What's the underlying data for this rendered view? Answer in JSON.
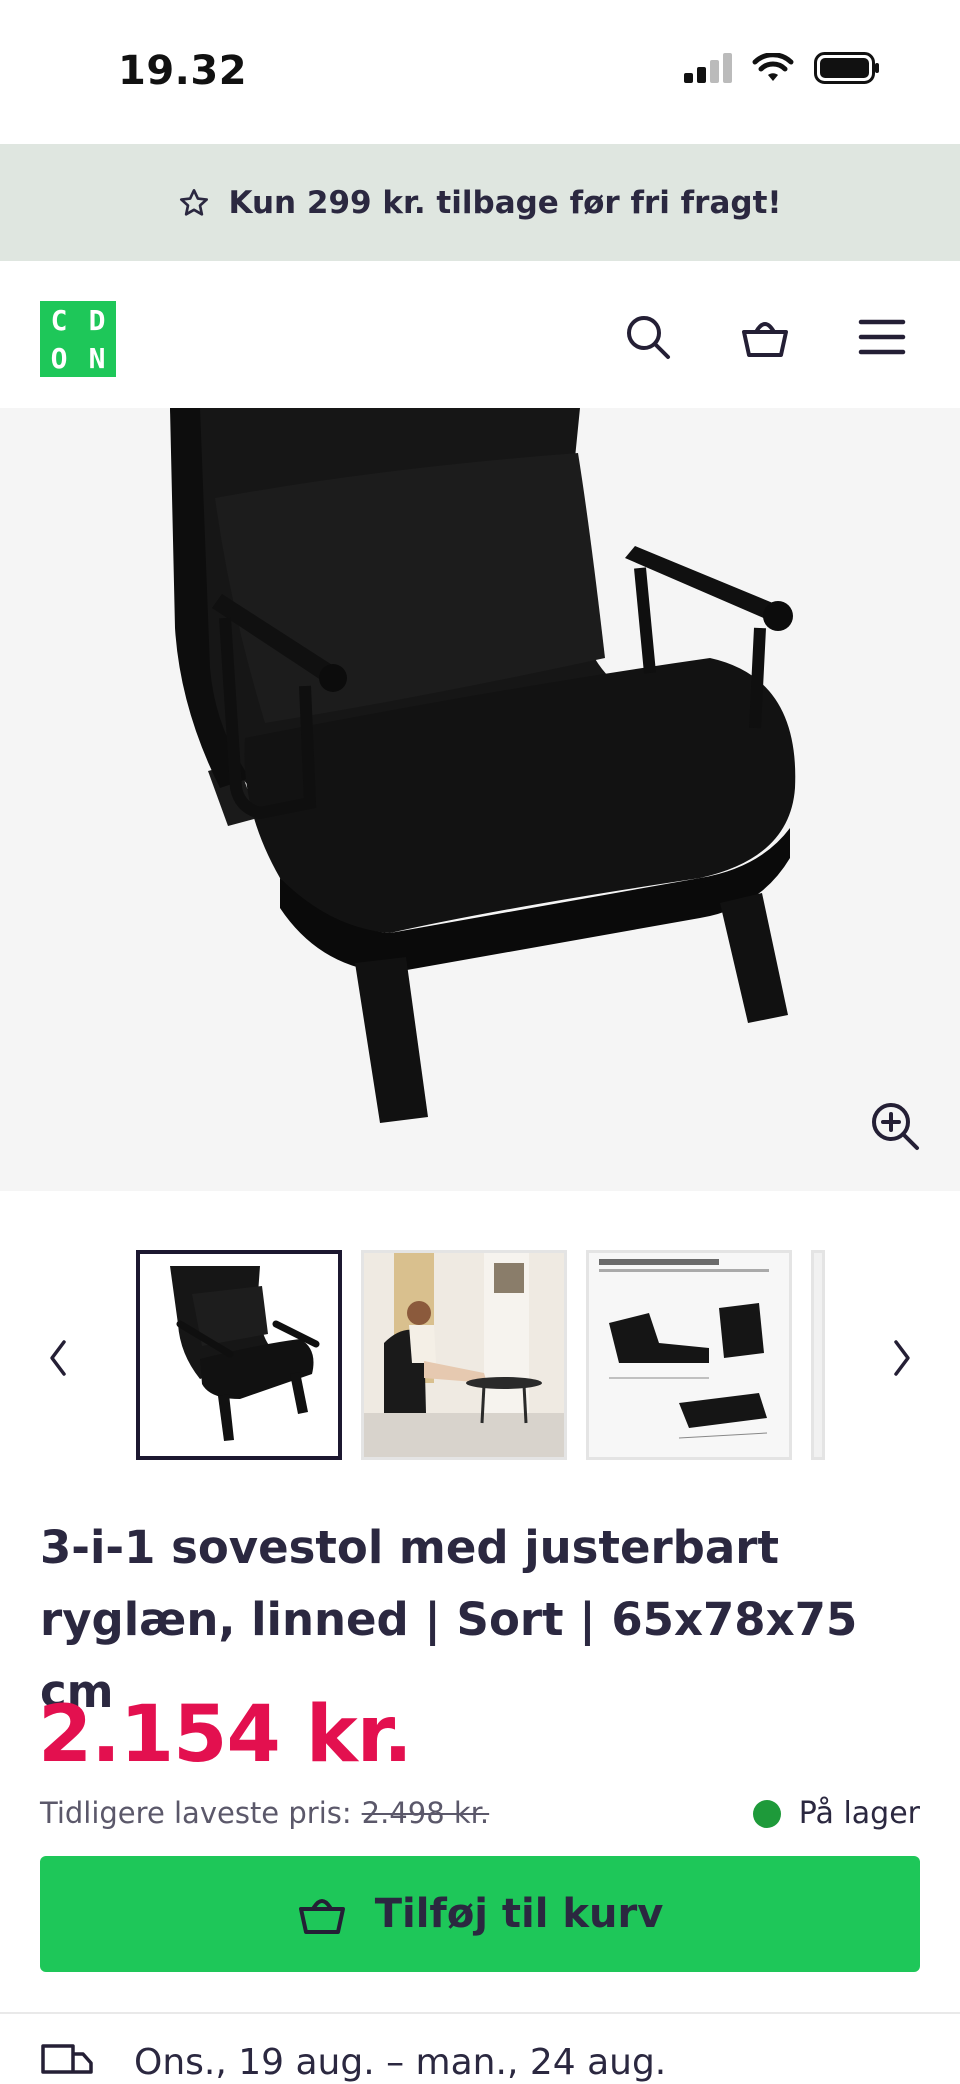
{
  "status_bar": {
    "time": "19.32"
  },
  "promo": {
    "text": "Kun 299 kr. tilbage før fri fragt!",
    "icon": "star-icon"
  },
  "header": {
    "logo": [
      "C",
      "D",
      "O",
      "N"
    ],
    "icons": [
      "search-icon",
      "basket-icon",
      "menu-icon"
    ]
  },
  "product": {
    "title": "3-i-1 sovestol med justerbart ryglæn, linned | Sort | 65x78x75 cm",
    "price": "2.154 kr.",
    "previous_lowest_label": "Tidligere laveste pris:",
    "previous_lowest_value": "2.498 kr.",
    "stock": "På lager",
    "add_to_cart": "Tilføj til kurv"
  },
  "gallery": {
    "thumbnail_count_visible": 4,
    "active_index": 0
  },
  "delivery": {
    "text": "Ons., 19 aug. – man., 24 aug."
  },
  "colors": {
    "accent_green": "#1ec759",
    "price_red": "#e3104f",
    "promo_bg": "#dfe6e0",
    "stock_dot": "#1e9a3a"
  }
}
